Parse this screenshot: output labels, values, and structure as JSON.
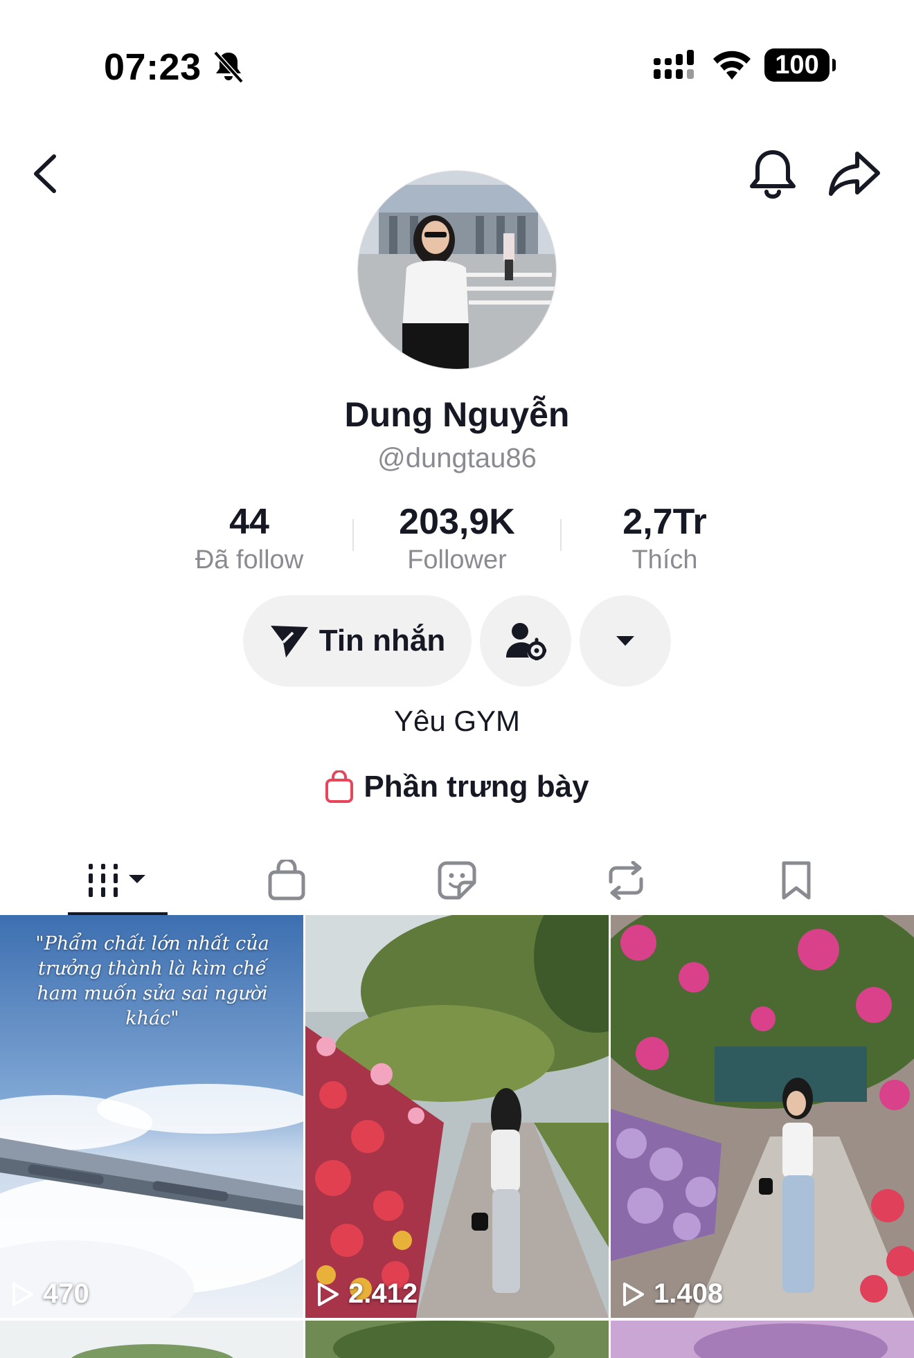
{
  "status_bar": {
    "time": "07:23",
    "battery": "100",
    "icons": [
      "bell-slash-icon",
      "cellular-signal-icon",
      "wifi-icon",
      "battery-icon"
    ]
  },
  "nav": {
    "icons": [
      "back-arrow-icon",
      "bell-icon",
      "share-icon"
    ]
  },
  "profile": {
    "display_name": "Dung Nguyễn",
    "username": "@dungtau86",
    "bio": "Yêu GYM"
  },
  "stats": [
    {
      "value": "44",
      "label": "Đã follow"
    },
    {
      "value": "203,9K",
      "label": "Follower"
    },
    {
      "value": "2,7Tr",
      "label": "Thích"
    }
  ],
  "actions": {
    "message_label": "Tin nhắn",
    "icons": [
      "send-icon",
      "user-settings-icon",
      "caret-down-icon"
    ]
  },
  "showcase": {
    "label": "Phần trưng bày",
    "accent": "#e8445a"
  },
  "tabs": [
    {
      "icon": "video-grid-icon",
      "active": true
    },
    {
      "icon": "shopping-bag-icon",
      "active": false
    },
    {
      "icon": "sticker-icon",
      "active": false
    },
    {
      "icon": "repost-icon",
      "active": false
    },
    {
      "icon": "bookmark-icon",
      "active": false
    }
  ],
  "videos": [
    {
      "views": "470",
      "caption": "\"Phẩm chất lớn nhất của trưởng thành là kìm chế ham muốn sửa sai người khác\""
    },
    {
      "views": "2.412"
    },
    {
      "views": "1.408"
    }
  ],
  "colors": {
    "text_primary": "#161823",
    "text_secondary": "#8a8b91",
    "button_bg": "#f1f1f2"
  }
}
